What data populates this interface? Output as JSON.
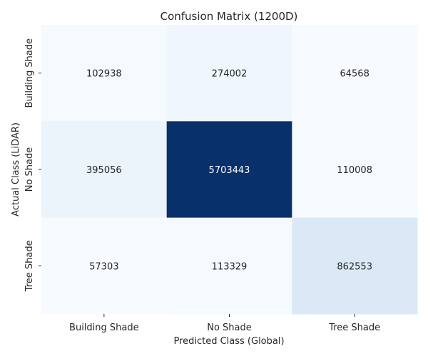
{
  "chart_data": {
    "type": "heatmap",
    "title": "Confusion Matrix (1200D)",
    "xlabel": "Predicted Class (Global)",
    "ylabel": "Actual Class (LiDAR)",
    "x_categories": [
      "Building Shade",
      "No Shade",
      "Tree Shade"
    ],
    "y_categories": [
      "Building Shade",
      "No Shade",
      "Tree Shade"
    ],
    "values": [
      [
        102938,
        274002,
        64568
      ],
      [
        395056,
        5703443,
        110008
      ],
      [
        57303,
        113329,
        862553
      ]
    ],
    "colormap": "Blues",
    "vmin": 57303,
    "vmax": 5703443,
    "colorbar": false,
    "grid": false,
    "colors": {
      "min": "#f7fbff",
      "max": "#08306b",
      "text_dark": "#262626",
      "text_light": "#ffffff"
    }
  }
}
